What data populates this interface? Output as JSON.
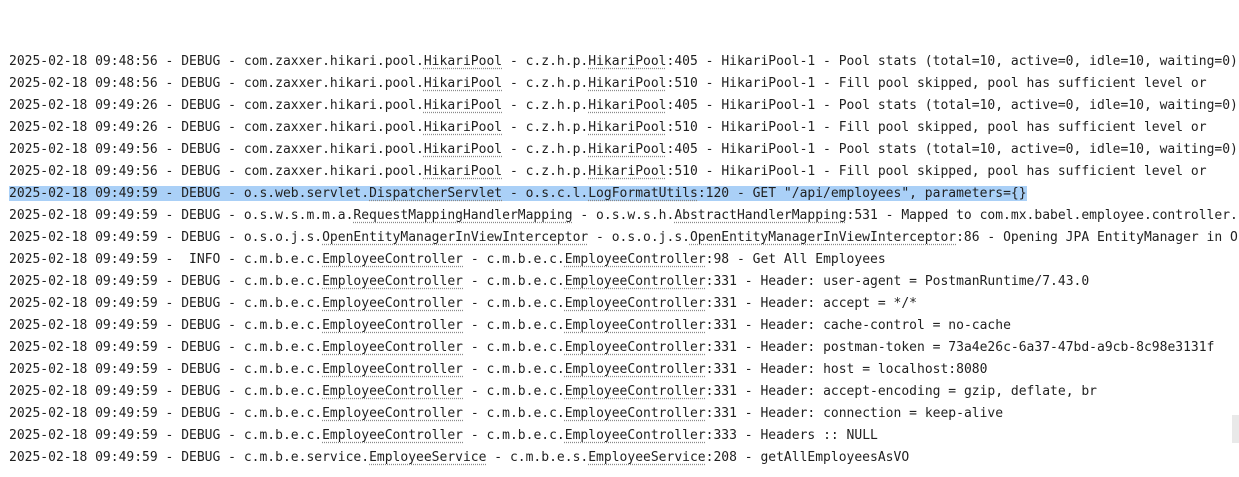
{
  "log_lines": [
    {
      "time": "2025-02-18 09:48:56",
      "level": "DEBUG",
      "logger_prefix": "com.zaxxer.hikari.pool.",
      "logger_class": "HikariPool",
      "source_prefix": "c.z.h.p.",
      "source_class": "HikariPool",
      "source_line": "405",
      "message": "HikariPool-1 - Pool stats (total=10, active=0, idle=10, waiting=0)",
      "selected": false
    },
    {
      "time": "2025-02-18 09:48:56",
      "level": "DEBUG",
      "logger_prefix": "com.zaxxer.hikari.pool.",
      "logger_class": "HikariPool",
      "source_prefix": "c.z.h.p.",
      "source_class": "HikariPool",
      "source_line": "510",
      "message": "HikariPool-1 - Fill pool skipped, pool has sufficient level or",
      "selected": false
    },
    {
      "time": "2025-02-18 09:49:26",
      "level": "DEBUG",
      "logger_prefix": "com.zaxxer.hikari.pool.",
      "logger_class": "HikariPool",
      "source_prefix": "c.z.h.p.",
      "source_class": "HikariPool",
      "source_line": "405",
      "message": "HikariPool-1 - Pool stats (total=10, active=0, idle=10, waiting=0)",
      "selected": false
    },
    {
      "time": "2025-02-18 09:49:26",
      "level": "DEBUG",
      "logger_prefix": "com.zaxxer.hikari.pool.",
      "logger_class": "HikariPool",
      "source_prefix": "c.z.h.p.",
      "source_class": "HikariPool",
      "source_line": "510",
      "message": "HikariPool-1 - Fill pool skipped, pool has sufficient level or",
      "selected": false
    },
    {
      "time": "2025-02-18 09:49:56",
      "level": "DEBUG",
      "logger_prefix": "com.zaxxer.hikari.pool.",
      "logger_class": "HikariPool",
      "source_prefix": "c.z.h.p.",
      "source_class": "HikariPool",
      "source_line": "405",
      "message": "HikariPool-1 - Pool stats (total=10, active=0, idle=10, waiting=0)",
      "selected": false
    },
    {
      "time": "2025-02-18 09:49:56",
      "level": "DEBUG",
      "logger_prefix": "com.zaxxer.hikari.pool.",
      "logger_class": "HikariPool",
      "source_prefix": "c.z.h.p.",
      "source_class": "HikariPool",
      "source_line": "510",
      "message": "HikariPool-1 - Fill pool skipped, pool has sufficient level or",
      "selected": false
    },
    {
      "time": "2025-02-18 09:49:59",
      "level": "DEBUG",
      "logger_prefix": "o.s.web.servlet.",
      "logger_class": "DispatcherServlet",
      "source_prefix": "o.s.c.l.",
      "source_class": "LogFormatUtils",
      "source_line": "120",
      "message": "GET \"/api/employees\", parameters={}",
      "selected": true
    },
    {
      "time": "2025-02-18 09:49:59",
      "level": "DEBUG",
      "logger_prefix": "o.s.w.s.m.m.a.",
      "logger_class": "RequestMappingHandlerMapping",
      "source_prefix": "o.s.w.s.h.",
      "source_class": "AbstractHandlerMapping",
      "source_line": "531",
      "message": "Mapped to com.mx.babel.employee.controller.EmployeeController#getAllEmployees()",
      "selected": false
    },
    {
      "time": "2025-02-18 09:49:59",
      "level": "DEBUG",
      "logger_prefix": "o.s.o.j.s.",
      "logger_class": "OpenEntityManagerInViewInterceptor",
      "source_prefix": "o.s.o.j.s.",
      "source_class": "OpenEntityManagerInViewInterceptor",
      "source_line": "86",
      "message": "Opening JPA EntityManager in OpenEntityManagerInViewInterceptor",
      "selected": false
    },
    {
      "time": "2025-02-18 09:49:59",
      "level": " INFO",
      "logger_prefix": "c.m.b.e.c.",
      "logger_class": "EmployeeController",
      "source_prefix": "c.m.b.e.c.",
      "source_class": "EmployeeController",
      "source_line": "98",
      "message": "Get All Employees",
      "selected": false
    },
    {
      "time": "2025-02-18 09:49:59",
      "level": "DEBUG",
      "logger_prefix": "c.m.b.e.c.",
      "logger_class": "EmployeeController",
      "source_prefix": "c.m.b.e.c.",
      "source_class": "EmployeeController",
      "source_line": "331",
      "message": "Header: user-agent = PostmanRuntime/7.43.0",
      "selected": false
    },
    {
      "time": "2025-02-18 09:49:59",
      "level": "DEBUG",
      "logger_prefix": "c.m.b.e.c.",
      "logger_class": "EmployeeController",
      "source_prefix": "c.m.b.e.c.",
      "source_class": "EmployeeController",
      "source_line": "331",
      "message": "Header: accept = */*",
      "selected": false
    },
    {
      "time": "2025-02-18 09:49:59",
      "level": "DEBUG",
      "logger_prefix": "c.m.b.e.c.",
      "logger_class": "EmployeeController",
      "source_prefix": "c.m.b.e.c.",
      "source_class": "EmployeeController",
      "source_line": "331",
      "message": "Header: cache-control = no-cache",
      "selected": false
    },
    {
      "time": "2025-02-18 09:49:59",
      "level": "DEBUG",
      "logger_prefix": "c.m.b.e.c.",
      "logger_class": "EmployeeController",
      "source_prefix": "c.m.b.e.c.",
      "source_class": "EmployeeController",
      "source_line": "331",
      "message": "Header: postman-token = 73a4e26c-6a37-47bd-a9cb-8c98e3131f",
      "selected": false
    },
    {
      "time": "2025-02-18 09:49:59",
      "level": "DEBUG",
      "logger_prefix": "c.m.b.e.c.",
      "logger_class": "EmployeeController",
      "source_prefix": "c.m.b.e.c.",
      "source_class": "EmployeeController",
      "source_line": "331",
      "message": "Header: host = localhost:8080",
      "selected": false
    },
    {
      "time": "2025-02-18 09:49:59",
      "level": "DEBUG",
      "logger_prefix": "c.m.b.e.c.",
      "logger_class": "EmployeeController",
      "source_prefix": "c.m.b.e.c.",
      "source_class": "EmployeeController",
      "source_line": "331",
      "message": "Header: accept-encoding = gzip, deflate, br",
      "selected": false
    },
    {
      "time": "2025-02-18 09:49:59",
      "level": "DEBUG",
      "logger_prefix": "c.m.b.e.c.",
      "logger_class": "EmployeeController",
      "source_prefix": "c.m.b.e.c.",
      "source_class": "EmployeeController",
      "source_line": "331",
      "message": "Header: connection = keep-alive",
      "selected": false
    },
    {
      "time": "2025-02-18 09:49:59",
      "level": "DEBUG",
      "logger_prefix": "c.m.b.e.c.",
      "logger_class": "EmployeeController",
      "source_prefix": "c.m.b.e.c.",
      "source_class": "EmployeeController",
      "source_line": "333",
      "message": "Headers :: NULL",
      "selected": false
    },
    {
      "time": "2025-02-18 09:49:59",
      "level": "DEBUG",
      "logger_prefix": "c.m.b.e.service.",
      "logger_class": "EmployeeService",
      "source_prefix": "c.m.b.e.s.",
      "source_class": "EmployeeService",
      "source_line": "208",
      "message": "getAllEmployeesAsVO",
      "selected": false
    }
  ],
  "separator": " - "
}
